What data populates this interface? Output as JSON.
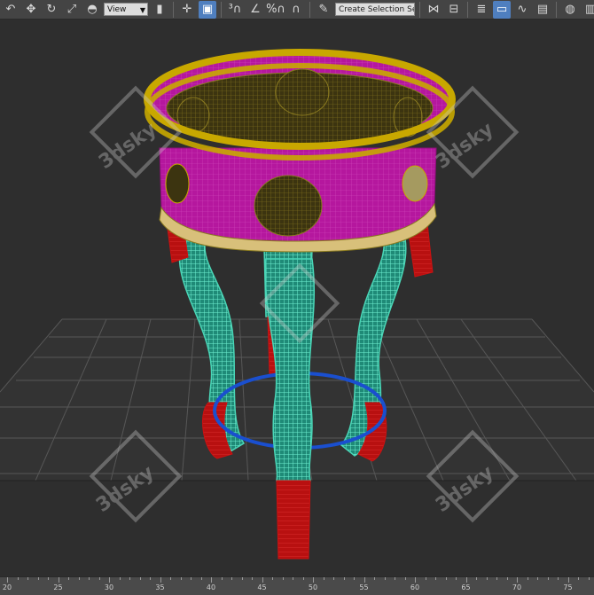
{
  "toolbar": {
    "items": [
      {
        "name": "undo-icon",
        "glyph": "↶"
      },
      {
        "name": "move-icon",
        "glyph": "✥"
      },
      {
        "name": "rotate-icon",
        "glyph": "↻"
      },
      {
        "name": "scale-icon",
        "glyph": "⤢"
      },
      {
        "name": "place-icon",
        "glyph": "◓"
      }
    ],
    "reference_coordinate_system": "View",
    "items2": [
      {
        "name": "pivot-icon",
        "glyph": "▮"
      },
      {
        "name": "select-and-manipulate-icon",
        "glyph": "✛"
      },
      {
        "name": "keyboard-shortcut-override-icon",
        "glyph": "▣",
        "active": true
      }
    ],
    "snaps": [
      {
        "name": "snap-3d-icon",
        "glyph": "³∩"
      },
      {
        "name": "angle-snap-icon",
        "glyph": "∠"
      },
      {
        "name": "percent-snap-icon",
        "glyph": "%∩"
      },
      {
        "name": "spinner-snap-icon",
        "glyph": "∩"
      },
      {
        "name": "edit-named-selection-icon",
        "glyph": "✎"
      }
    ],
    "named_selection_placeholder": "Create Selection Se",
    "items3": [
      {
        "name": "mirror-icon",
        "glyph": "⋈"
      },
      {
        "name": "align-icon",
        "glyph": "⊟"
      },
      {
        "name": "layer-explorer-icon",
        "glyph": "≣"
      },
      {
        "name": "toggle-ribbon-icon",
        "glyph": "▭",
        "active": true
      },
      {
        "name": "curve-editor-icon",
        "glyph": "∿"
      },
      {
        "name": "schematic-view-icon",
        "glyph": "▤"
      },
      {
        "name": "material-editor-icon",
        "glyph": "◍"
      },
      {
        "name": "render-setup-icon",
        "glyph": "▥"
      }
    ]
  },
  "watermark_text": "3dsky",
  "ruler": {
    "ticks": [
      "20",
      "25",
      "30",
      "35",
      "40",
      "45",
      "50",
      "55",
      "60",
      "65",
      "70",
      "75"
    ]
  },
  "colors": {
    "viewport_bg": "#2e2e2e",
    "grid": "#575757",
    "ring_top": "#c8a800",
    "apron": "#b5179e",
    "legs": "#4ad6b7",
    "feet": "#cc1111",
    "circle_gizmo": "#1a4fcf"
  }
}
